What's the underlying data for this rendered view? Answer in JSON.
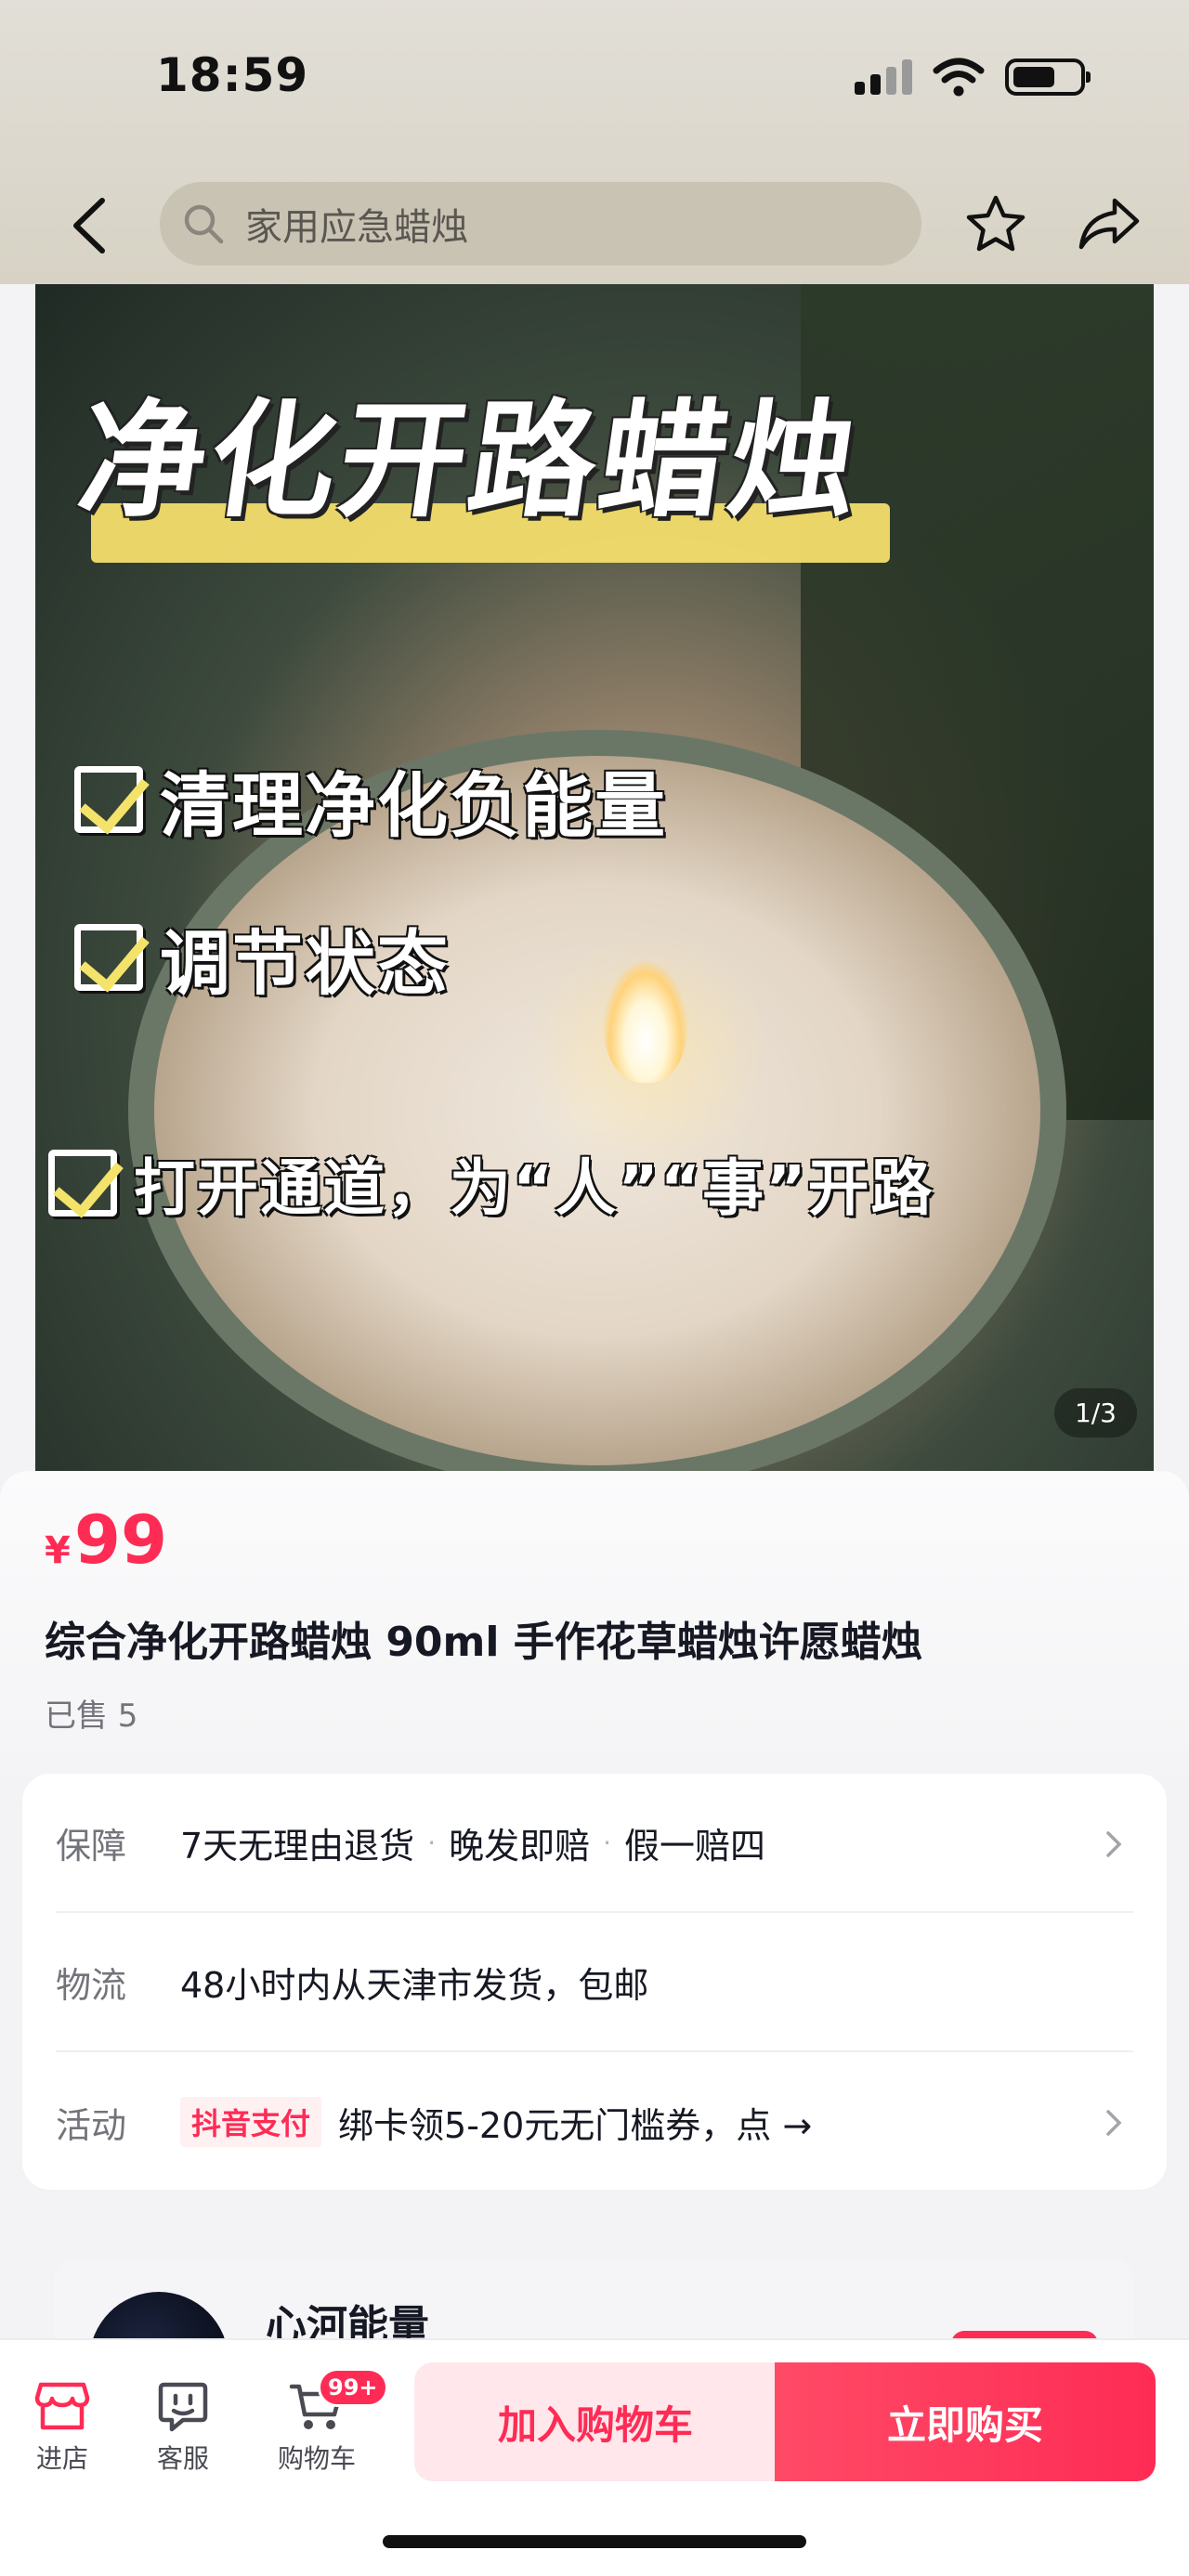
{
  "status_bar": {
    "time": "18:59"
  },
  "nav": {
    "search_text": "家用应急蜡烛"
  },
  "product_image": {
    "title": "净化开路蜡烛",
    "lines": [
      "清理净化负能量",
      "调节状态",
      "打开通道，为“人”“事”开路"
    ],
    "pager": "1/3"
  },
  "product": {
    "currency": "¥",
    "price": "99",
    "title": "综合净化开路蜡烛 90ml 手作花草蜡烛许愿蜡烛",
    "sold": "已售 5"
  },
  "info": {
    "guarantee_label": "保障",
    "guarantee_items": [
      "7天无理由退货",
      "晚发即赔",
      "假一赔四"
    ],
    "logistics_label": "物流",
    "logistics_value": "48小时内从天津市发货，包邮",
    "promo_label": "活动",
    "promo_tag": "抖音支付",
    "promo_value": "绑卡领5-20元无门槛券，点 →"
  },
  "shop": {
    "name": "心河能量"
  },
  "bottom_bar": {
    "store_label": "进店",
    "service_label": "客服",
    "cart_label": "购物车",
    "cart_badge": "99+",
    "add_cart_label": "加入购物车",
    "buy_label": "立即购买"
  },
  "colors": {
    "accent": "#fe2c55"
  }
}
